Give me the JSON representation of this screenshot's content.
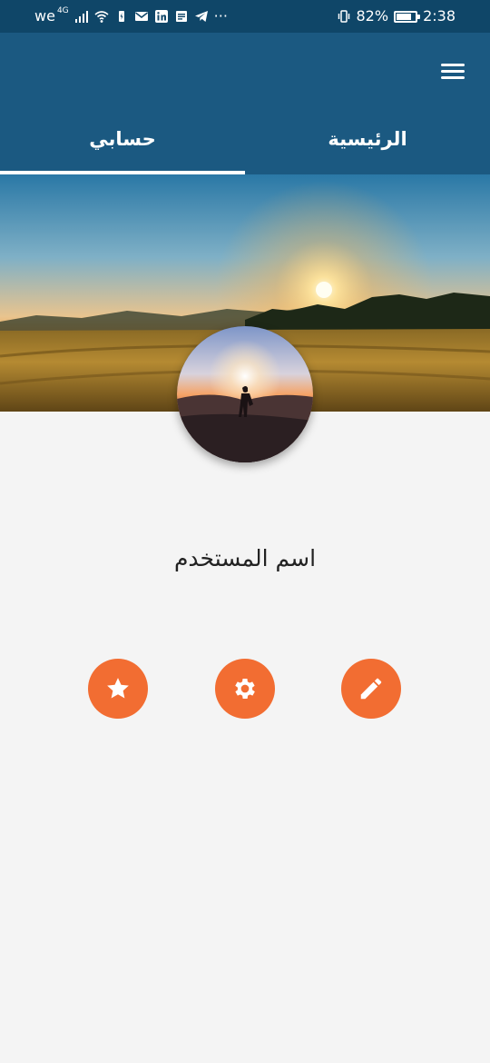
{
  "status_bar": {
    "carrier": "we",
    "network": "4G",
    "battery_percent": "82%",
    "battery_level": 0.82,
    "time": "2:38",
    "more": "···",
    "icons": [
      "signal-icon",
      "wifi-icon",
      "battery-saver-icon",
      "mail-icon",
      "linkedin-icon",
      "message-icon",
      "telegram-icon",
      "vibrate-icon",
      "battery-icon"
    ]
  },
  "header": {
    "menu_icon": "hamburger-menu-icon",
    "background": "#1b5981",
    "tabs": [
      {
        "label": "الرئيسية",
        "active": false
      },
      {
        "label": "حسابي",
        "active": true
      }
    ]
  },
  "profile": {
    "cover_image": "sunset-field-photo",
    "avatar_image": "person-silhouette-sunset-photo",
    "user_name": "اسم المستخدم"
  },
  "actions": {
    "accent": "#f26d32",
    "buttons": [
      {
        "icon": "star-icon"
      },
      {
        "icon": "gear-icon"
      },
      {
        "icon": "pencil-icon"
      }
    ]
  }
}
